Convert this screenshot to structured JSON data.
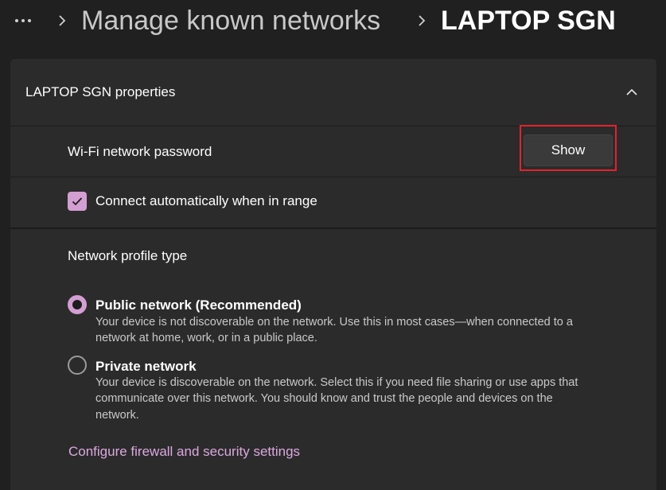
{
  "breadcrumb": {
    "parent": "Manage known networks",
    "current": "LAPTOP SGN"
  },
  "card": {
    "title": "LAPTOP SGN properties",
    "password_label": "Wi-Fi network password",
    "show_button": "Show",
    "auto_connect": {
      "label": "Connect automatically when in range",
      "checked": true
    },
    "profile": {
      "title": "Network profile type",
      "options": [
        {
          "title": "Public network (Recommended)",
          "desc_1": "Your device is not discoverable on the network. Use this in most cases—when connected to a",
          "desc_2": "network at home, work, or in a public place.",
          "selected": true
        },
        {
          "title": "Private network",
          "desc_1": "Your device is discoverable on the network. Select this if you need file sharing or use apps that",
          "desc_2": "communicate over this network. You should know and trust the people and devices on the",
          "desc_3": "network.",
          "selected": false
        }
      ]
    },
    "firewall_link": "Configure firewall and security settings"
  },
  "colors": {
    "background": "#202020",
    "card": "#2b2b2b",
    "accent": "#d39fd3",
    "link": "#dba8e0",
    "highlight": "#e1232e"
  },
  "icons": [
    "more-icon",
    "chevron-right-icon",
    "chevron-up-icon",
    "checkmark-icon"
  ]
}
